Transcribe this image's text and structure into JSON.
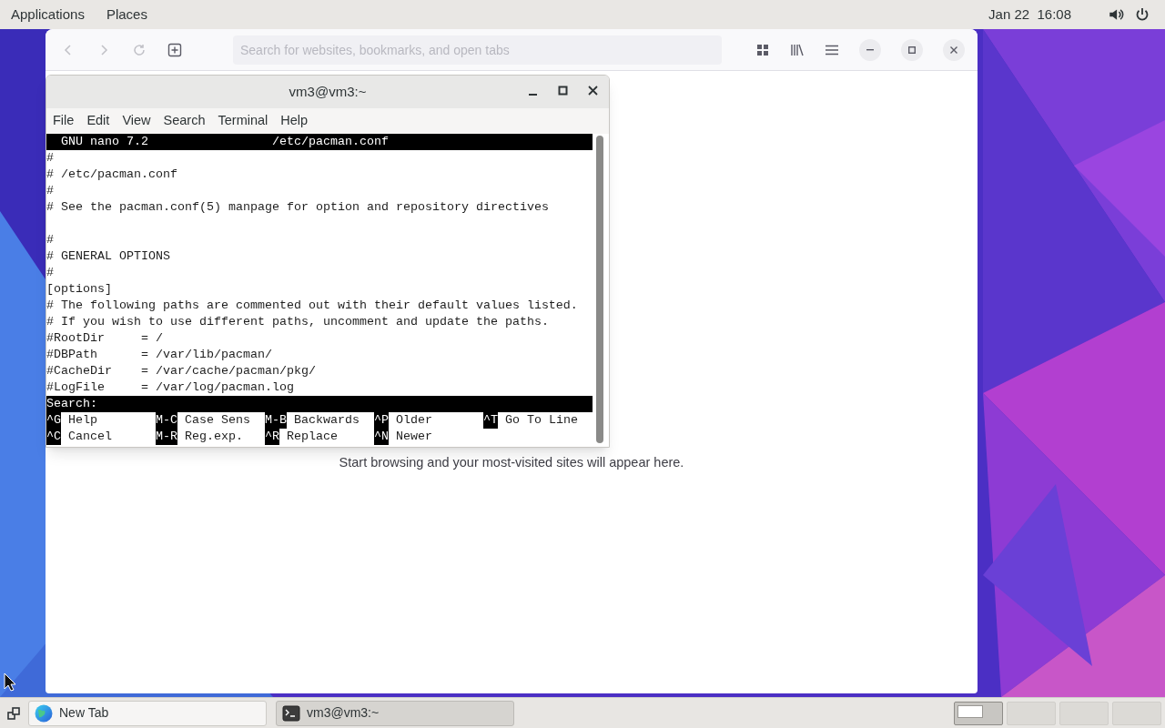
{
  "top_bar": {
    "menus": [
      "Applications",
      "Places"
    ],
    "clock": "Jan 22  16:08"
  },
  "browser": {
    "search": {
      "placeholder": "Search for websites, bookmarks, and open tabs"
    },
    "message": "Start browsing and your most-visited sites will appear here."
  },
  "terminal": {
    "title": "vm3@vm3:~",
    "menus": [
      "File",
      "Edit",
      "View",
      "Search",
      "Terminal",
      "Help"
    ],
    "nano": {
      "version": "GNU nano 7.2",
      "filename": "/etc/pacman.conf",
      "lines": [
        {
          "kind": "text",
          "text": "#"
        },
        {
          "kind": "text",
          "text": "# /etc/pacman.conf"
        },
        {
          "kind": "text",
          "text": "#"
        },
        {
          "kind": "text",
          "text": "# See the pacman.conf(5) manpage for option and repository directives"
        },
        {
          "kind": "blank"
        },
        {
          "kind": "text",
          "text": "#"
        },
        {
          "kind": "text",
          "text": "# GENERAL OPTIONS"
        },
        {
          "kind": "text",
          "text": "#"
        },
        {
          "kind": "text",
          "text": "[options]"
        },
        {
          "kind": "text",
          "text": "# The following paths are commented out with their default values listed."
        },
        {
          "kind": "text",
          "text": "# If you wish to use different paths, uncomment and update the paths."
        },
        {
          "kind": "text",
          "text": "#RootDir     = /"
        },
        {
          "kind": "text",
          "text": "#DBPath      = /var/lib/pacman/"
        },
        {
          "kind": "text",
          "text": "#CacheDir    = /var/cache/pacman/pkg/"
        },
        {
          "kind": "text",
          "text": "#LogFile     = /var/log/pacman.log"
        }
      ],
      "prompt": "Search:",
      "shortcut_rows": [
        [
          {
            "key": "^G",
            "label": "Help"
          },
          {
            "key": "M-C",
            "label": "Case Sens"
          },
          {
            "key": "M-B",
            "label": "Backwards"
          },
          {
            "key": "^P",
            "label": "Older"
          },
          {
            "key": "^T",
            "label": "Go To Line"
          }
        ],
        [
          {
            "key": "^C",
            "label": "Cancel"
          },
          {
            "key": "M-R",
            "label": "Reg.exp."
          },
          {
            "key": "^R",
            "label": "Replace"
          },
          {
            "key": "^N",
            "label": "Newer"
          }
        ]
      ]
    }
  },
  "taskbar": {
    "windows": [
      {
        "kind": "browser",
        "label": "New Tab",
        "selected": false
      },
      {
        "kind": "terminal",
        "label": "vm3@vm3:~",
        "selected": true
      }
    ],
    "workspaces": [
      {
        "selected": true
      },
      {
        "selected": false
      },
      {
        "selected": false
      },
      {
        "selected": false
      }
    ]
  }
}
